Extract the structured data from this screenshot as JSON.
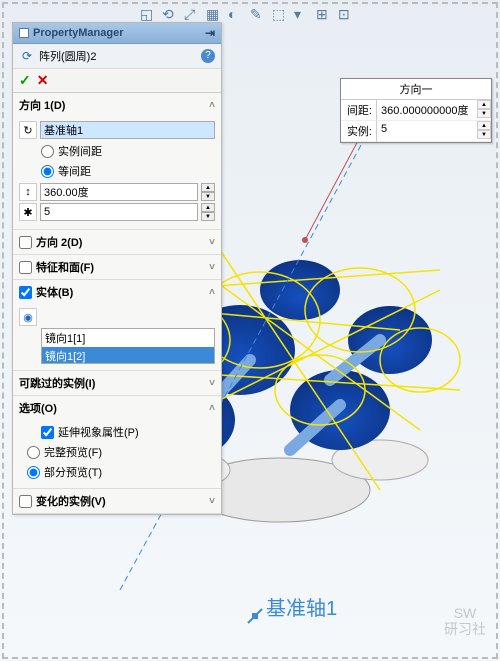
{
  "pm_title": "PropertyManager",
  "feature_name": "阵列(圆周)2",
  "sections": {
    "dir1": {
      "title": "方向 1(D)",
      "axis": "基准轴1",
      "radio_instance": "实例间距",
      "radio_equal": "等间距",
      "angle": "360.00度",
      "count": "5"
    },
    "dir2": {
      "title": "方向 2(D)"
    },
    "feat_face": {
      "title": "特征和面(F)"
    },
    "bodies": {
      "title": "实体(B)",
      "items": [
        "镜向1[1]",
        "镜向1[2]"
      ]
    },
    "skip": {
      "title": "可跳过的实例(I)"
    },
    "options": {
      "title": "选项(O)",
      "ext_visual": "延伸视象属性(P)",
      "full_preview": "完整预览(F)",
      "partial_preview": "部分预览(T)"
    },
    "vary": {
      "title": "变化的实例(V)"
    }
  },
  "callout": {
    "title": "方向一",
    "spacing_label": "间距:",
    "spacing_value": "360.000000000度",
    "count_label": "实例:",
    "count_value": "5"
  },
  "axis_label": "基准轴1",
  "watermark_a": "SW",
  "watermark_b": "研习社"
}
